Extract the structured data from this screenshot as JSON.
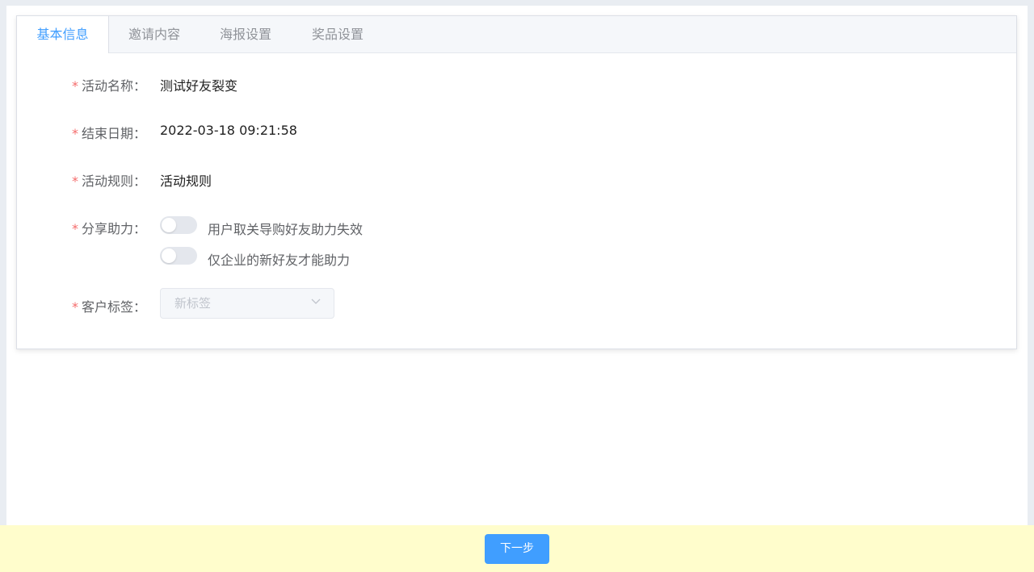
{
  "tabs": [
    {
      "label": "基本信息",
      "active": true
    },
    {
      "label": "邀请内容",
      "active": false
    },
    {
      "label": "海报设置",
      "active": false
    },
    {
      "label": "奖品设置",
      "active": false
    }
  ],
  "form": {
    "required_mark": "*",
    "activity_name": {
      "label": "活动名称：",
      "value": "测试好友裂变"
    },
    "end_date": {
      "label": "结束日期：",
      "value": "2022-03-18 09:21:58"
    },
    "activity_rules": {
      "label": "活动规则：",
      "value": "活动规则"
    },
    "share_assist": {
      "label": "分享助力：",
      "options": [
        {
          "text": "用户取关导购好友助力失效",
          "enabled": false
        },
        {
          "text": "仅企业的新好友才能助力",
          "enabled": false
        }
      ]
    },
    "customer_tag": {
      "label": "客户标签：",
      "placeholder": "新标签",
      "disabled": true
    }
  },
  "footer": {
    "next_label": "下一步"
  },
  "colors": {
    "primary": "#409eff",
    "required": "#f56c6c",
    "footer_bg": "#fffdcc",
    "switch_off": "#e4e7ed"
  }
}
